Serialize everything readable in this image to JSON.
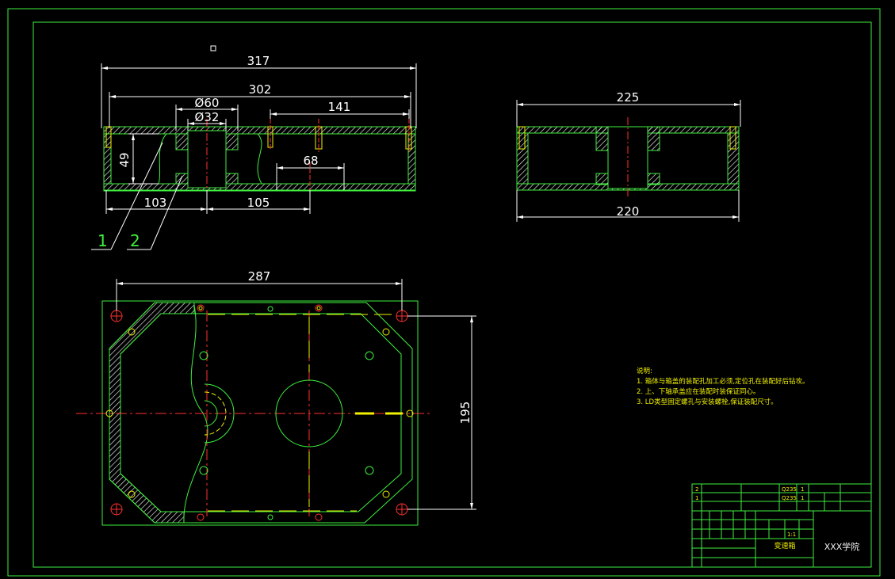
{
  "drawing": {
    "colors": {
      "background": "#000000",
      "frame": "#3ef03e",
      "dimension": "#ffffff",
      "center_line": "#ff3030",
      "hidden": "#f0f000",
      "hatch": "#ffffff",
      "hole": "#3ef03e"
    }
  },
  "front_view": {
    "dims": {
      "overall_length": "317",
      "inner_length": "302",
      "bore_outer": "Ø60",
      "bore_inner": "Ø32",
      "offset_141": "141",
      "height": "49",
      "offset_68": "68",
      "left_103": "103",
      "right_105": "105"
    },
    "leaders": {
      "label_1": "1",
      "label_2": "2"
    }
  },
  "side_view": {
    "dims": {
      "top_width": "225",
      "bottom_width": "220"
    }
  },
  "top_view": {
    "dims": {
      "length": "287",
      "width": "195"
    }
  },
  "notes": {
    "title": "说明:",
    "lines": [
      "1. 箱体与箱盖的装配孔加工必须,定位孔在装配好后钻攻。",
      "2. 上、下轴承盖应在装配时装保证同心。",
      "3. LD类型固定螺孔与安装螺栓,保证装配尺寸。"
    ]
  },
  "title_block": {
    "school": "XXX学院",
    "part_name": "变速箱",
    "scale": "1:1",
    "row_numbers": [
      "2",
      "1"
    ],
    "row_materials": [
      "Q235",
      "Q235"
    ],
    "quantities": [
      "1",
      "1"
    ]
  }
}
